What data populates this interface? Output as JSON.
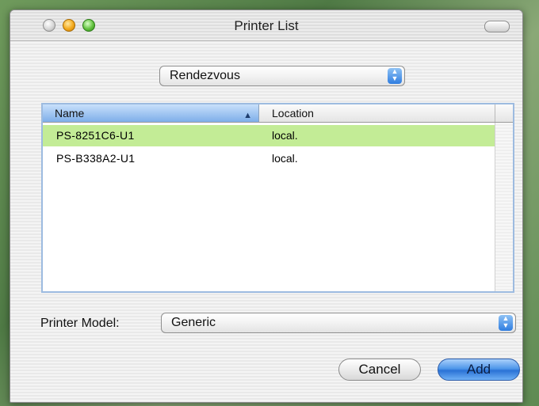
{
  "window": {
    "title": "Printer List"
  },
  "connection_popup": {
    "selected": "Rendezvous"
  },
  "printer_table": {
    "columns": [
      "Name",
      "Location"
    ],
    "rows": [
      {
        "name": "PS-8251C6-U1",
        "location": "local.",
        "selected": true
      },
      {
        "name": "PS-B338A2-U1",
        "location": "local.",
        "selected": false
      }
    ],
    "sort_column": "Name"
  },
  "printer_model": {
    "label": "Printer Model:",
    "selected": "Generic"
  },
  "buttons": {
    "cancel": "Cancel",
    "add": "Add"
  },
  "colors": {
    "selection": "#c3ec96",
    "default_button": "#2a72d6",
    "header_sorted": "#7eaee9"
  },
  "icons": {
    "sort": "sort-ascending-icon",
    "stepper": "popup-stepper-icon"
  }
}
